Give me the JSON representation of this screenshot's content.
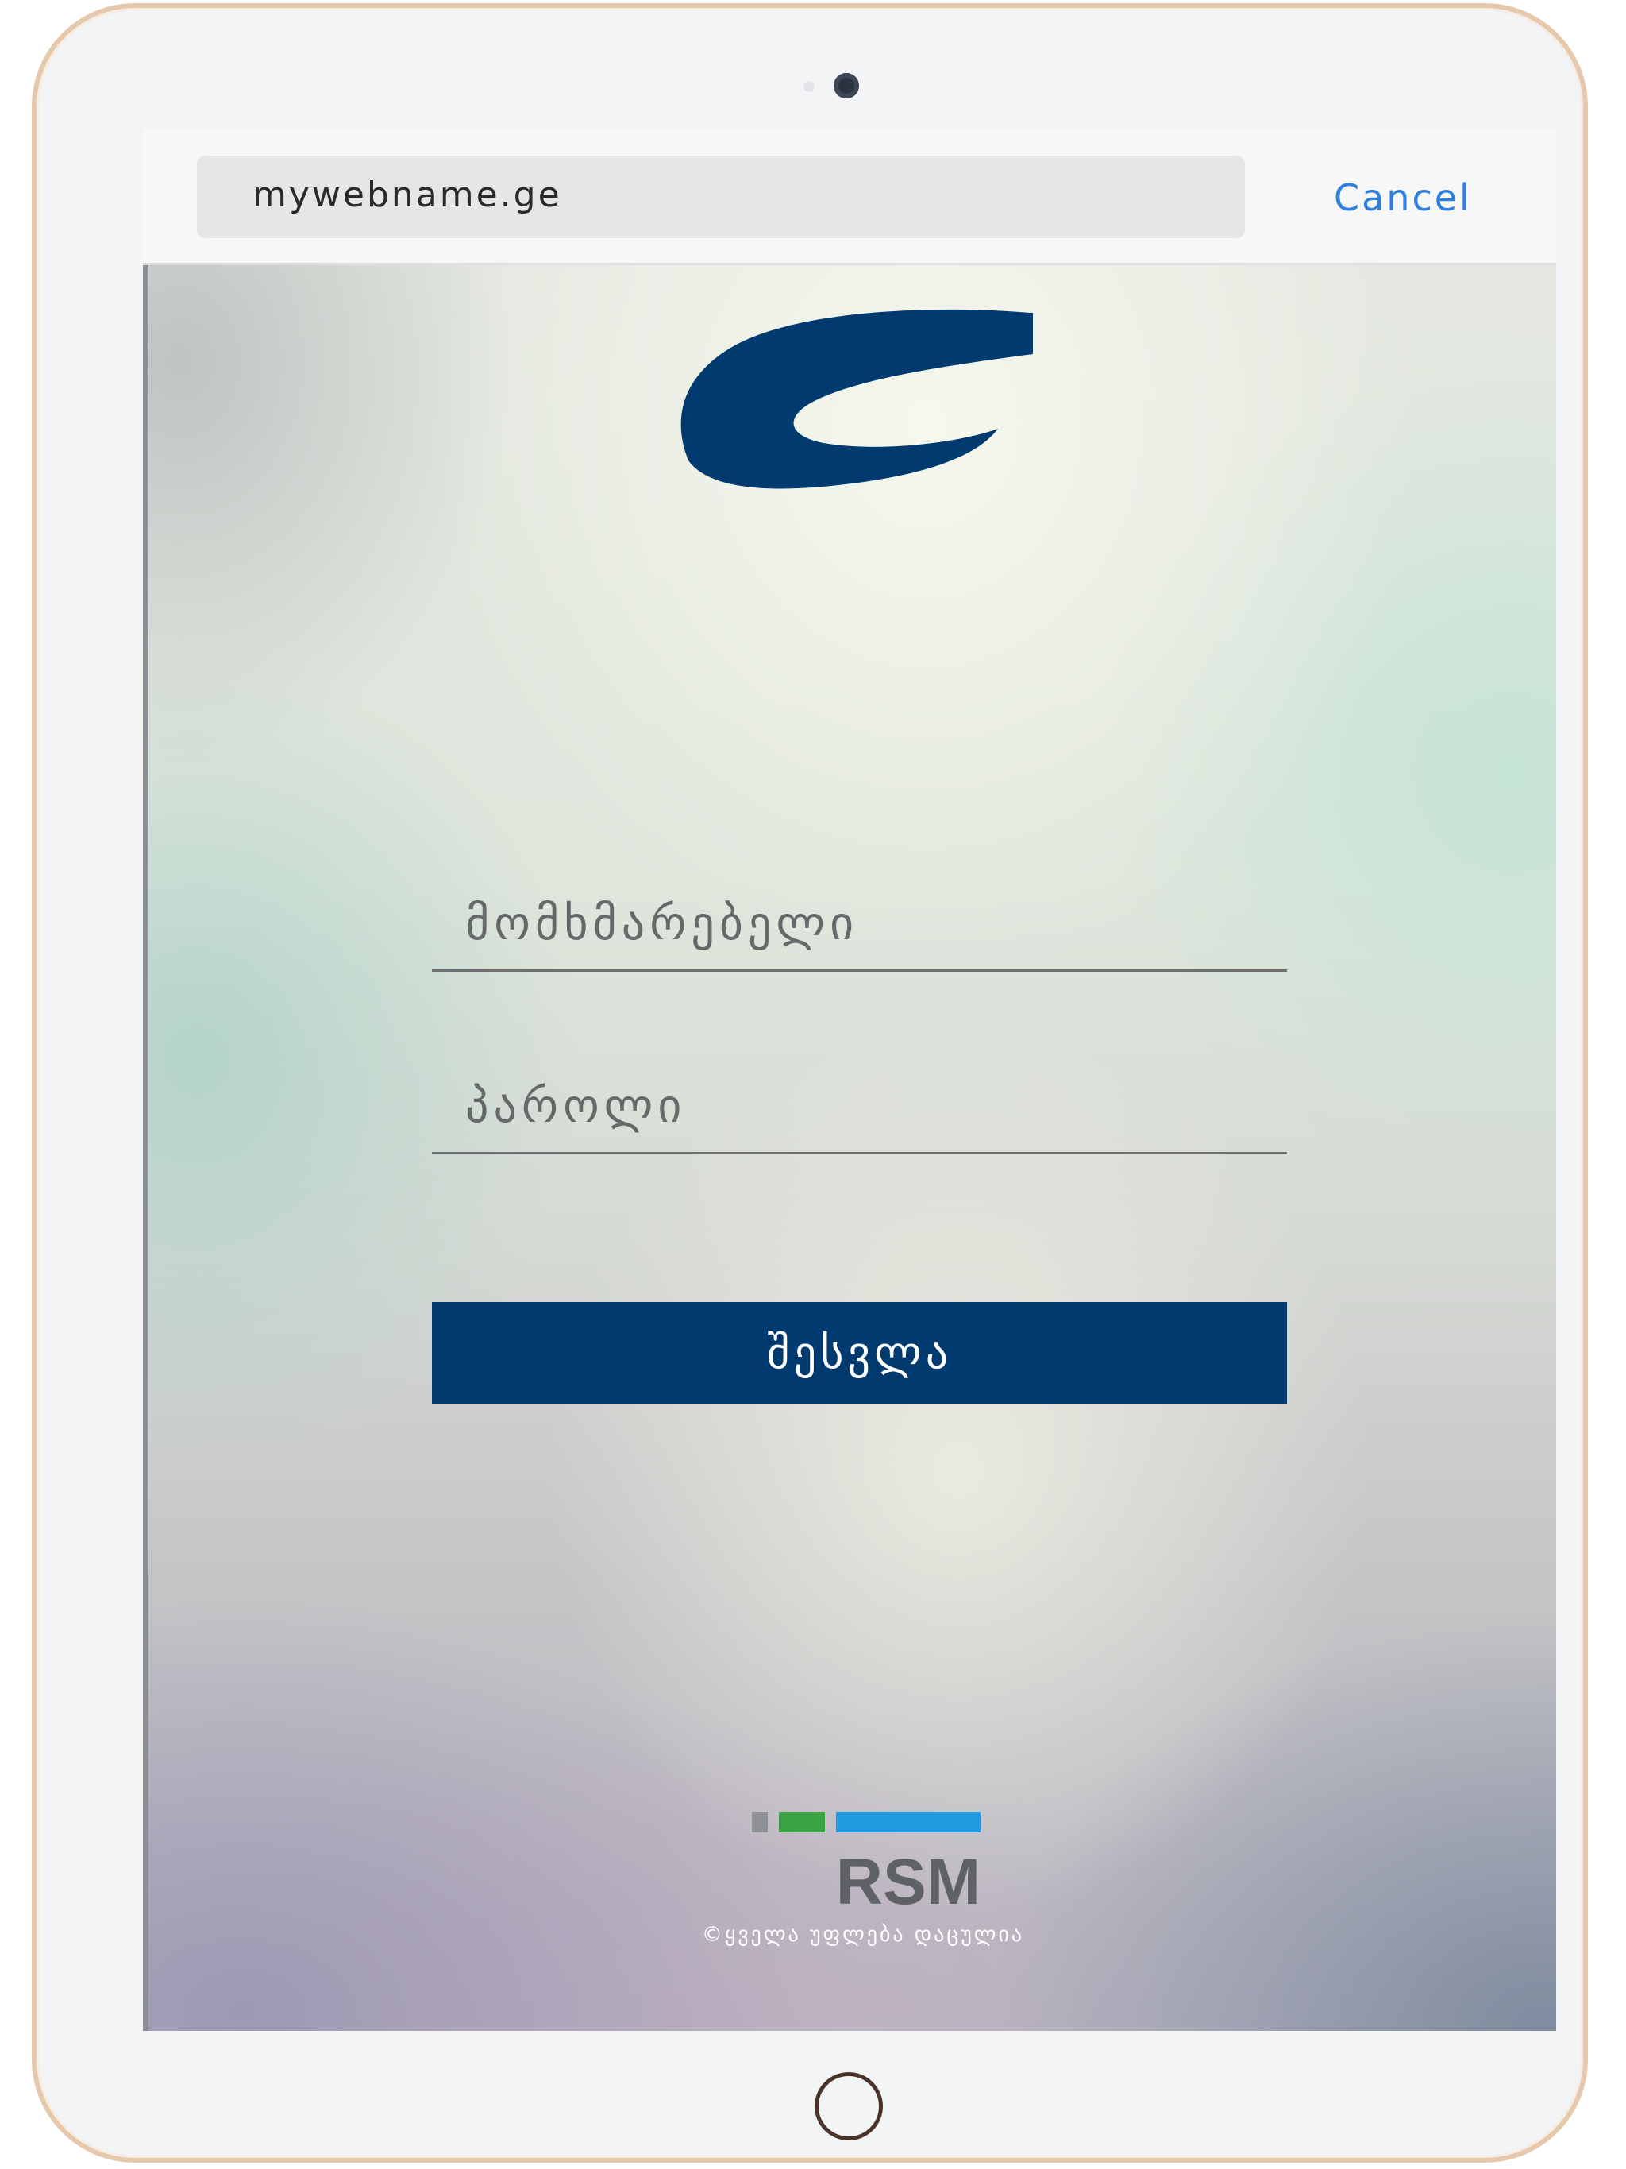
{
  "browser": {
    "url": "mywebname.ge",
    "cancel_label": "Cancel"
  },
  "login": {
    "username_placeholder": "მომხმარებელი",
    "password_placeholder": "პაროლი",
    "submit_label": "შესვლა"
  },
  "footer": {
    "brand_text": "RSM",
    "copyright": "©ყველა უფლება დაცულია"
  },
  "colors": {
    "brand_blue": "#003a6e",
    "link_blue": "#2f7fe0",
    "rsm_grey": "#8e9194",
    "rsm_green": "#3aa244",
    "rsm_blue": "#1f9ae0",
    "rsm_text": "#5f6264"
  },
  "icons": {
    "logo": "company-swoosh-logo",
    "camera": "front-camera",
    "home": "home-button"
  }
}
